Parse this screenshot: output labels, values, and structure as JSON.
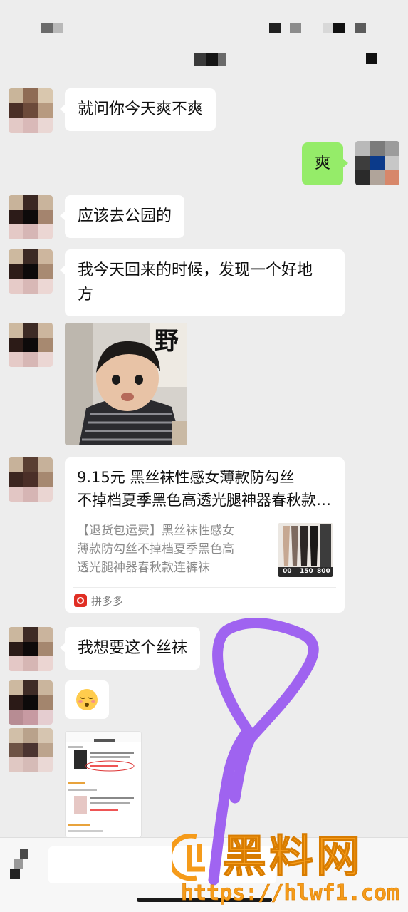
{
  "messages": {
    "m1": "就问你今天爽不爽",
    "m2": "爽",
    "m3": "应该去公园的",
    "m4_line1": "我今天回来的时候，发现一个好地",
    "m4_line2": "方",
    "sticker_text": "野",
    "m7": "我想要这个丝袜"
  },
  "product_card": {
    "title_line1": "9.15元 黑丝袜性感女薄款防勾丝",
    "title_line2": "不掉档夏季黑色高透光腿神器春秋款连裤袜",
    "desc_line1": "【退货包运费】黑丝袜性感女",
    "desc_line2": "薄款防勾丝不掉档夏季黑色高",
    "desc_line3": "透光腿神器春秋款连裤袜",
    "source": "拼多多",
    "thumb_labels": [
      "00",
      "150",
      "800"
    ]
  },
  "watermark": {
    "name": "黑料网",
    "url": "https://hlwf1.com"
  },
  "colors": {
    "chat_bg": "#ededed",
    "my_bubble": "#95ec69",
    "their_bubble": "#ffffff",
    "scribble": "#9b5cf0",
    "watermark": "#f59b1a",
    "pinduoduo": "#e02e24"
  }
}
